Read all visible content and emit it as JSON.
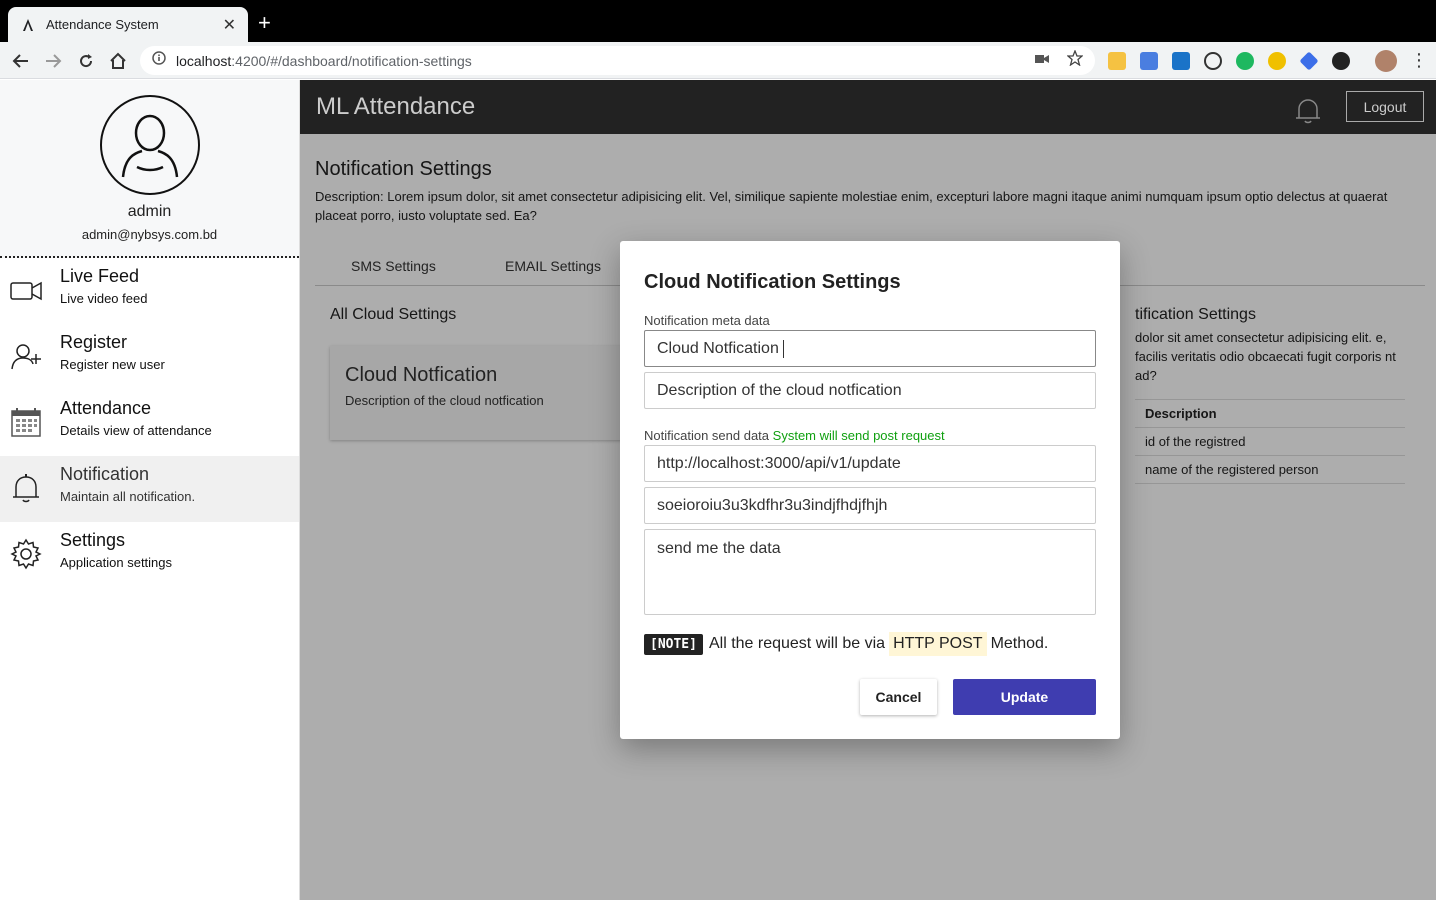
{
  "browser": {
    "tab_title": "Attendance System",
    "url_host": "localhost",
    "url_rest": ":4200/#/dashboard/notification-settings"
  },
  "sidebar": {
    "user_name": "admin",
    "user_email": "admin@nybsys.com.bd",
    "items": [
      {
        "title": "Live Feed",
        "subtitle": "Live video feed",
        "icon": "video-camera-icon"
      },
      {
        "title": "Register",
        "subtitle": "Register new user",
        "icon": "add-user-icon"
      },
      {
        "title": "Attendance",
        "subtitle": "Details view of attendance",
        "icon": "calendar-icon"
      },
      {
        "title": "Notification",
        "subtitle": "Maintain all notification.",
        "icon": "bell-icon"
      },
      {
        "title": "Settings",
        "subtitle": "Application settings",
        "icon": "gear-icon"
      }
    ]
  },
  "header": {
    "app_title": "ML Attendance",
    "logout_label": "Logout"
  },
  "page": {
    "title": "Notification Settings",
    "description": "Description: Lorem ipsum dolor, sit amet consectetur adipisicing elit. Vel, similique sapiente molestiae enim, excepturi labore magni itaque animi numquam ipsum optio delectus at quaerat placeat porro, iusto voluptate sed. Ea?",
    "tabs": [
      "SMS Settings",
      "EMAIL Settings"
    ],
    "all_cloud_label": "All Cloud Settings",
    "card": {
      "title": "Cloud Notfication",
      "description": "Description of the cloud notfication"
    },
    "right_panel": {
      "title": "tification Settings",
      "text": "dolor sit amet consectetur adipisicing elit. e, facilis veritatis odio obcaecati fugit corporis nt ad?",
      "table_header": "Description",
      "rows": [
        "id of the registred",
        "name of the registered person"
      ]
    }
  },
  "dialog": {
    "title": "Cloud Notification Settings",
    "meta_label": "Notification meta data",
    "name_value": "Cloud Notfication",
    "description_value": "Description of the cloud notfication",
    "send_label": "Notification send data",
    "send_hint": "System will send post request",
    "url_value": "http://localhost:3000/api/v1/update",
    "token_value": "soeioroiu3u3kdfhr3u3indjfhdjfhjh",
    "message_value": "send me the data",
    "note_tag": "[NOTE]",
    "note_text_before": "All the request will be via",
    "note_code": "HTTP POST",
    "note_text_after": "Method.",
    "cancel_label": "Cancel",
    "update_label": "Update"
  },
  "colors": {
    "primary": "#3f3db0",
    "hint_green": "#10a010",
    "appbar": "#222222"
  }
}
